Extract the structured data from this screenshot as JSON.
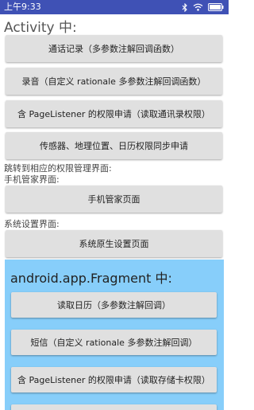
{
  "status_bar": {
    "time": "上午9:33",
    "icons": [
      "bluetooth-icon",
      "wifi-icon",
      "battery-icon"
    ],
    "color": "#3f51b5"
  },
  "activity": {
    "title": "Activity 中:",
    "buttons": [
      "通话记录（多参数注解回调函数）",
      "录音（自定义 rationale 多参数注解回调函数）",
      "含 PageListener 的权限申请（读取通讯录权限）",
      "传感器、地理位置、日历权限同步申请"
    ],
    "jump_label": "跳转到相应的权限管理界面:",
    "phone_manager_label": "手机管家界面:",
    "phone_manager_button": "手机管家页面",
    "system_settings_label": "系统设置界面:",
    "system_settings_button": "系统原生设置页面"
  },
  "fragment": {
    "title": "android.app.Fragment 中:",
    "background_color": "#87cefa",
    "buttons": [
      "读取日历（多参数注解回调）",
      "短信（自定义 rationale 多参数注解回调）",
      "含 PageListener 的权限申请（读取存储卡权限）"
    ]
  }
}
